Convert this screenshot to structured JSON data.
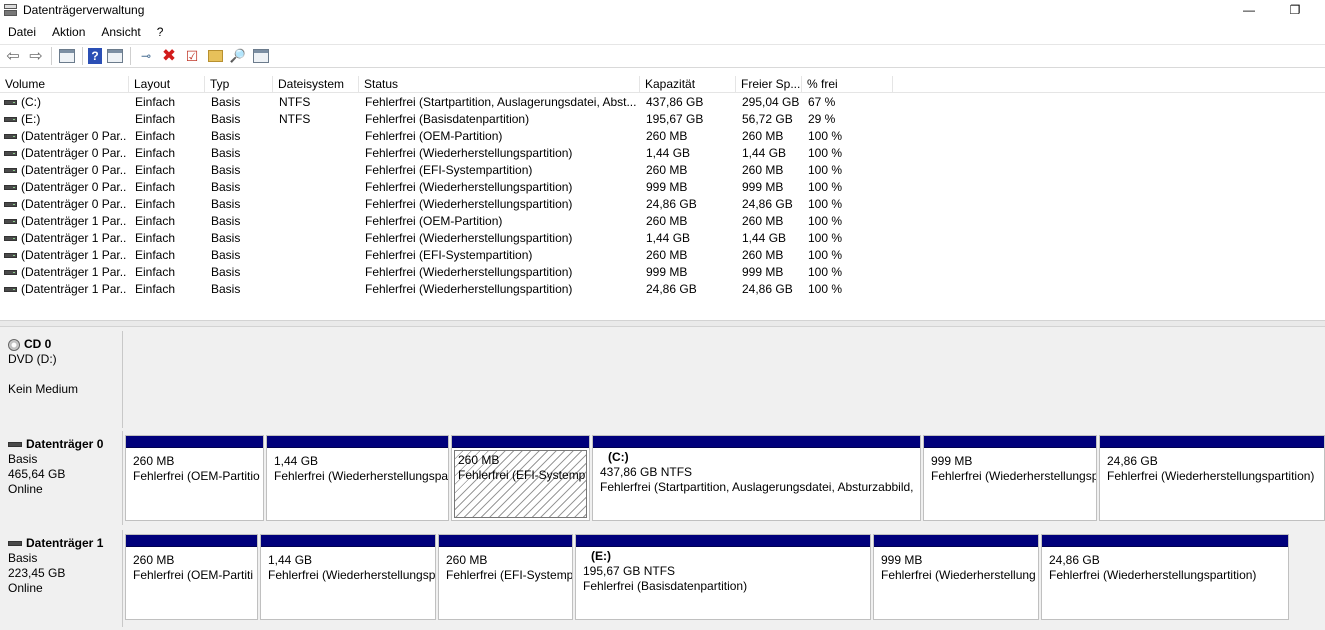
{
  "window": {
    "title": "Datenträgerverwaltung",
    "minimize_glyph": "—",
    "maximize_glyph": "❐"
  },
  "menu": {
    "items": [
      "Datei",
      "Aktion",
      "Ansicht",
      "?"
    ]
  },
  "toolbar": {
    "icons": [
      "back-icon",
      "forward-icon",
      "panel-icon",
      "help-icon",
      "panel-icon",
      "connect-icon",
      "delete-icon",
      "properties-icon",
      "folder-up-icon",
      "search-icon",
      "panel-icon"
    ],
    "help_glyph": "?",
    "delete_glyph": "✖"
  },
  "volume_table": {
    "columns": [
      "Volume",
      "Layout",
      "Typ",
      "Dateisystem",
      "Status",
      "Kapazität",
      "Freier Sp...",
      "% frei"
    ],
    "rows": [
      {
        "volume": "(C:)",
        "layout": "Einfach",
        "typ": "Basis",
        "fs": "NTFS",
        "status": "Fehlerfrei (Startpartition, Auslagerungsdatei, Abst...",
        "cap": "437,86 GB",
        "free": "295,04 GB",
        "pct": "67 %"
      },
      {
        "volume": "(E:)",
        "layout": "Einfach",
        "typ": "Basis",
        "fs": "NTFS",
        "status": "Fehlerfrei (Basisdatenpartition)",
        "cap": "195,67 GB",
        "free": "56,72 GB",
        "pct": "29 %"
      },
      {
        "volume": "(Datenträger 0 Par...",
        "layout": "Einfach",
        "typ": "Basis",
        "fs": "",
        "status": "Fehlerfrei (OEM-Partition)",
        "cap": "260 MB",
        "free": "260 MB",
        "pct": "100 %"
      },
      {
        "volume": "(Datenträger 0 Par...",
        "layout": "Einfach",
        "typ": "Basis",
        "fs": "",
        "status": "Fehlerfrei (Wiederherstellungspartition)",
        "cap": "1,44 GB",
        "free": "1,44 GB",
        "pct": "100 %"
      },
      {
        "volume": "(Datenträger 0 Par...",
        "layout": "Einfach",
        "typ": "Basis",
        "fs": "",
        "status": "Fehlerfrei (EFI-Systempartition)",
        "cap": "260 MB",
        "free": "260 MB",
        "pct": "100 %"
      },
      {
        "volume": "(Datenträger 0 Par...",
        "layout": "Einfach",
        "typ": "Basis",
        "fs": "",
        "status": "Fehlerfrei (Wiederherstellungspartition)",
        "cap": "999 MB",
        "free": "999 MB",
        "pct": "100 %"
      },
      {
        "volume": "(Datenträger 0 Par...",
        "layout": "Einfach",
        "typ": "Basis",
        "fs": "",
        "status": "Fehlerfrei (Wiederherstellungspartition)",
        "cap": "24,86 GB",
        "free": "24,86 GB",
        "pct": "100 %"
      },
      {
        "volume": "(Datenträger 1 Par...",
        "layout": "Einfach",
        "typ": "Basis",
        "fs": "",
        "status": "Fehlerfrei (OEM-Partition)",
        "cap": "260 MB",
        "free": "260 MB",
        "pct": "100 %"
      },
      {
        "volume": "(Datenträger 1 Par...",
        "layout": "Einfach",
        "typ": "Basis",
        "fs": "",
        "status": "Fehlerfrei (Wiederherstellungspartition)",
        "cap": "1,44 GB",
        "free": "1,44 GB",
        "pct": "100 %"
      },
      {
        "volume": "(Datenträger 1 Par...",
        "layout": "Einfach",
        "typ": "Basis",
        "fs": "",
        "status": "Fehlerfrei (EFI-Systempartition)",
        "cap": "260 MB",
        "free": "260 MB",
        "pct": "100 %"
      },
      {
        "volume": "(Datenträger 1 Par...",
        "layout": "Einfach",
        "typ": "Basis",
        "fs": "",
        "status": "Fehlerfrei (Wiederherstellungspartition)",
        "cap": "999 MB",
        "free": "999 MB",
        "pct": "100 %"
      },
      {
        "volume": "(Datenträger 1 Par...",
        "layout": "Einfach",
        "typ": "Basis",
        "fs": "",
        "status": "Fehlerfrei (Wiederherstellungspartition)",
        "cap": "24,86 GB",
        "free": "24,86 GB",
        "pct": "100 %"
      }
    ]
  },
  "cd0": {
    "name": "CD 0",
    "line1": "DVD (D:)",
    "line2": "Kein Medium"
  },
  "disk0": {
    "name": "Datenträger 0",
    "type": "Basis",
    "size": "465,64 GB",
    "state": "Online",
    "partitions": [
      {
        "label": "",
        "size": "260 MB",
        "status": "Fehlerfrei (OEM-Partitio"
      },
      {
        "label": "",
        "size": "1,44 GB",
        "status": "Fehlerfrei (Wiederherstellungspa"
      },
      {
        "label": "",
        "size": "260 MB",
        "status": "Fehlerfrei (EFI-Systempa"
      },
      {
        "label": "(C:)",
        "size": "437,86 GB NTFS",
        "status": "Fehlerfrei (Startpartition, Auslagerungsdatei, Absturzabbild,"
      },
      {
        "label": "",
        "size": "999 MB",
        "status": "Fehlerfrei (Wiederherstellungsp"
      },
      {
        "label": "",
        "size": "24,86 GB",
        "status": "Fehlerfrei (Wiederherstellungspartition)"
      }
    ]
  },
  "disk1": {
    "name": "Datenträger 1",
    "type": "Basis",
    "size": "223,45 GB",
    "state": "Online",
    "partitions": [
      {
        "label": "",
        "size": "260 MB",
        "status": "Fehlerfrei (OEM-Partiti"
      },
      {
        "label": "",
        "size": "1,44 GB",
        "status": "Fehlerfrei (Wiederherstellungsp"
      },
      {
        "label": "",
        "size": "260 MB",
        "status": "Fehlerfrei (EFI-Systemp"
      },
      {
        "label": "(E:)",
        "size": "195,67 GB NTFS",
        "status": "Fehlerfrei (Basisdatenpartition)"
      },
      {
        "label": "",
        "size": "999 MB",
        "status": "Fehlerfrei (Wiederherstellung"
      },
      {
        "label": "",
        "size": "24,86 GB",
        "status": "Fehlerfrei (Wiederherstellungspartition)"
      }
    ]
  },
  "colors": {
    "partition_bar": "#00007b",
    "panel_bg": "#f0f0f0"
  }
}
